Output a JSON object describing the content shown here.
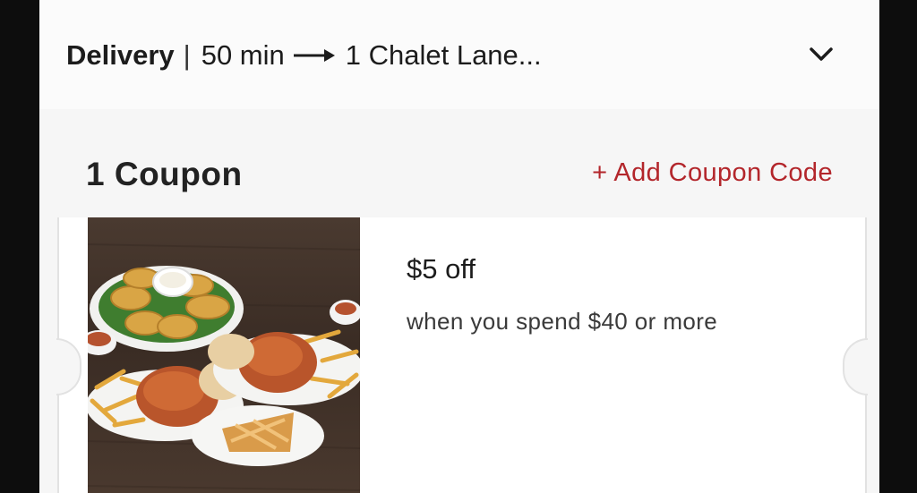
{
  "delivery": {
    "mode": "Delivery",
    "separator": "|",
    "time": "50 min",
    "address": "1 Chalet Lane..."
  },
  "coupons": {
    "count_label": "1 Coupon",
    "add_code_label": "+ Add Coupon Code",
    "items": [
      {
        "title": "$5 off",
        "description": "when you spend $40 or more",
        "image": "chicken-meal-platter-photo"
      }
    ]
  },
  "icons": {
    "arrow": "right-arrow-icon",
    "chevron": "chevron-down-icon"
  },
  "colors": {
    "accent": "#b3262b",
    "text": "#1c1c1c",
    "background": "#f6f6f6"
  }
}
